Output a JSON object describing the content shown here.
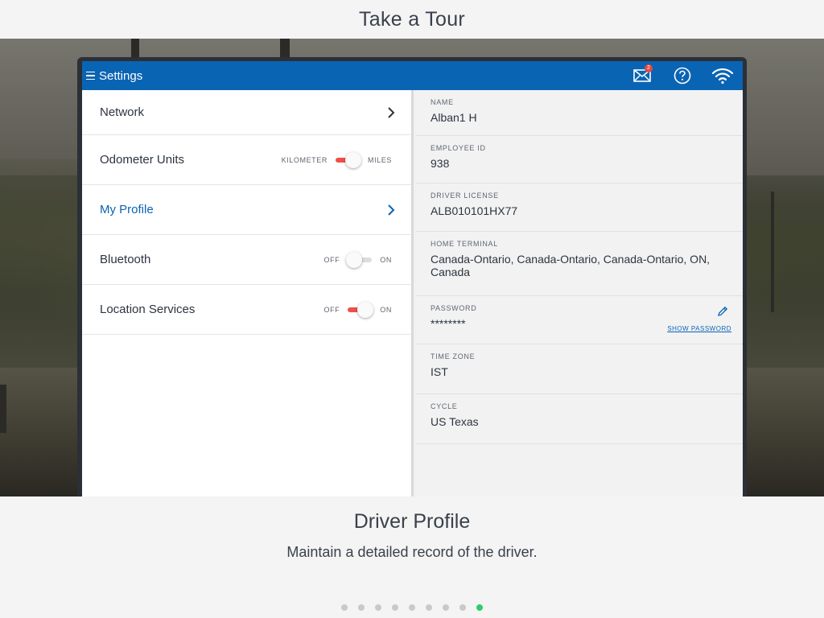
{
  "tour": {
    "title": "Take a Tour",
    "slide_title": "Driver Profile",
    "slide_description": "Maintain a detailed record of the driver.",
    "dots_total": 9,
    "active_dot": 9
  },
  "appbar": {
    "title": "Settings",
    "mail_badge": "2",
    "icons": [
      "menu-icon",
      "mail-icon",
      "help-icon",
      "wifi-icon"
    ]
  },
  "settings": {
    "network": "Network",
    "odometer": {
      "label": "Odometer Units",
      "off_label": "KILOMETER",
      "on_label": "MILES",
      "state": "on"
    },
    "my_profile": "My Profile",
    "bluetooth": {
      "label": "Bluetooth",
      "off_label": "OFF",
      "on_label": "ON",
      "state": "off"
    },
    "location": {
      "label": "Location Services",
      "off_label": "OFF",
      "on_label": "ON",
      "state": "on"
    }
  },
  "profile": {
    "name": {
      "label": "NAME",
      "value": "Alban1 H"
    },
    "employee_id": {
      "label": "EMPLOYEE ID",
      "value": "938"
    },
    "driver_license": {
      "label": "DRIVER LICENSE",
      "value": "ALB010101HX77"
    },
    "home_terminal": {
      "label": "HOME TERMINAL",
      "value": "Canada-Ontario, Canada-Ontario, Canada-Ontario, ON, Canada"
    },
    "password": {
      "label": "PASSWORD",
      "value": "********",
      "show_label": "SHOW PASSWORD"
    },
    "time_zone": {
      "label": "TIME ZONE",
      "value": "IST"
    },
    "cycle": {
      "label": "CYCLE",
      "value": "US Texas"
    }
  },
  "colors": {
    "brand_blue": "#0a64b4",
    "toggle_on": "#ef4f4b",
    "active_dot": "#2ecc71",
    "badge": "#e5493e"
  }
}
